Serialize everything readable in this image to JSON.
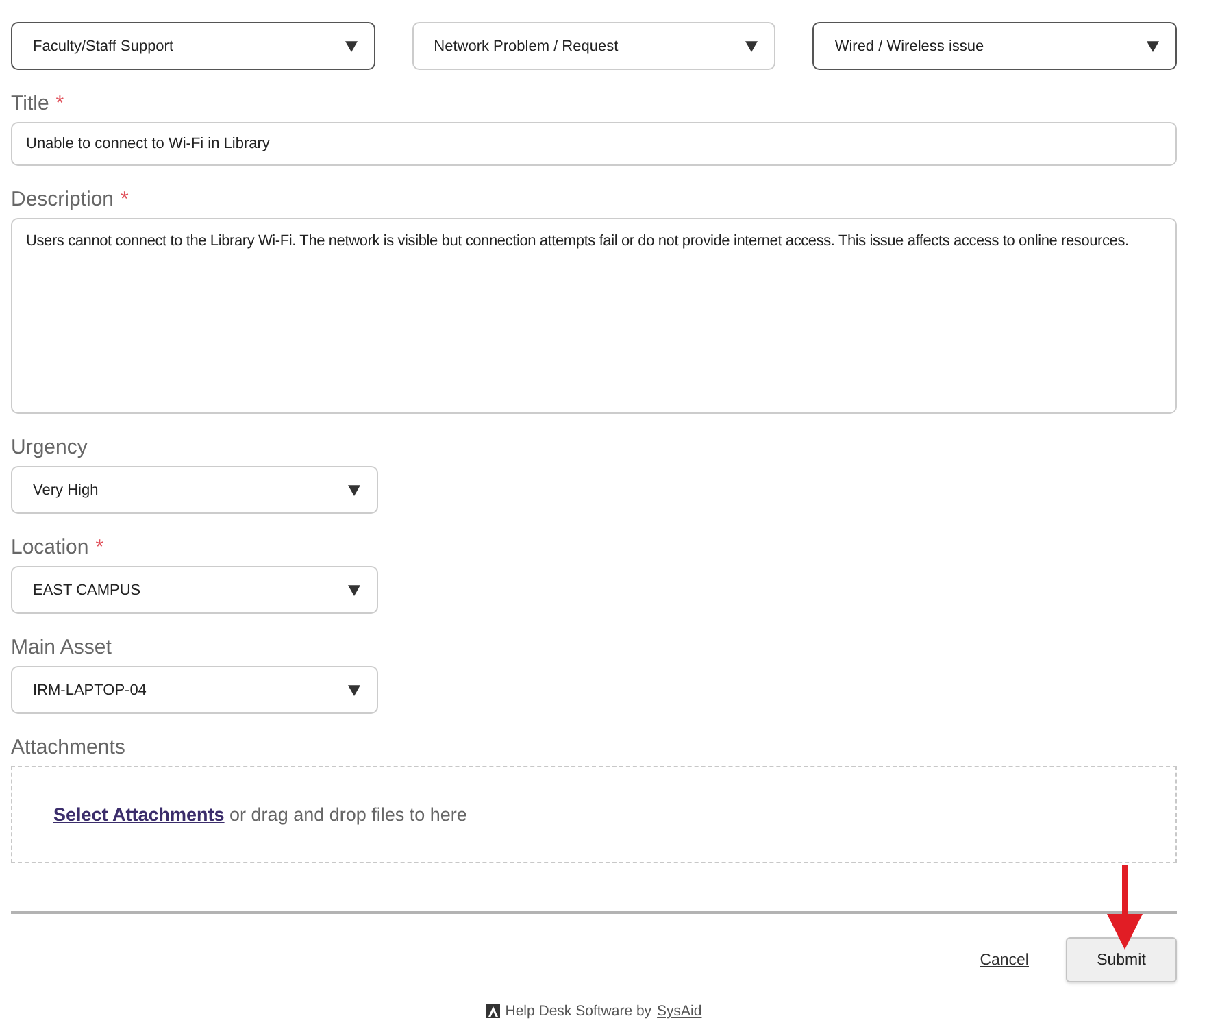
{
  "category_selects": [
    {
      "value": "Faculty/Staff Support",
      "highlighted": true
    },
    {
      "value": "Network Problem / Request",
      "highlighted": false
    },
    {
      "value": "Wired / Wireless issue",
      "highlighted": true
    }
  ],
  "title_field": {
    "label": "Title",
    "mark": "*",
    "value": "Unable to connect to Wi-Fi in Library"
  },
  "description_field": {
    "label": "Description",
    "mark": "*",
    "value": "Users cannot connect to the Library Wi-Fi. The network is visible but connection attempts fail or do not provide internet access. This issue affects access to online resources."
  },
  "fields": [
    {
      "label": "Urgency",
      "value": "Very High"
    },
    {
      "label": "Location",
      "mark": "*",
      "value": "EAST CAMPUS"
    },
    {
      "label": "Main Asset",
      "value": "IRM-LAPTOP-04"
    }
  ],
  "attachments": {
    "label": "Attachments",
    "link": "Select Attachments",
    "text": "or drag and drop files to here"
  },
  "actions": {
    "cancel": "Cancel",
    "submit": "Submit"
  },
  "footer": {
    "text": "Help Desk Software by",
    "link": "SysAid"
  },
  "annotations": [
    {
      "kind": "arrow"
    }
  ]
}
